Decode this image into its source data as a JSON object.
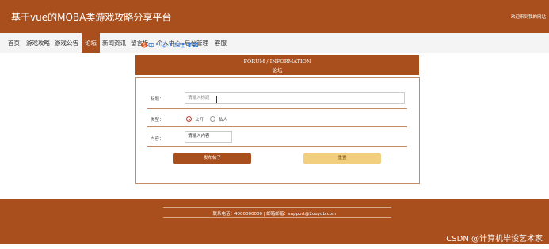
{
  "header": {
    "site_title": "基于vue的MOBA类游戏攻略分享平台",
    "welcome": "欢迎来到我的网站"
  },
  "nav": {
    "items": [
      {
        "label": "首页"
      },
      {
        "label": "游戏攻略"
      },
      {
        "label": "游戏公告"
      },
      {
        "label": "论坛",
        "active": true
      },
      {
        "label": "新闻资讯"
      },
      {
        "label": "留言板"
      },
      {
        "label": "个人中心"
      },
      {
        "label": "后台管理"
      },
      {
        "label": "客服"
      }
    ]
  },
  "toolbar": {
    "icons": [
      "sogou-s-icon",
      "chinese-zhong-icon",
      "punctuation-icon",
      "emoji-icon",
      "microphone-icon",
      "keyboard-icon",
      "user-icon",
      "shirt-icon",
      "grid-icon"
    ]
  },
  "section": {
    "title_en": "FORUM / INFORMATION",
    "title_cn": "论坛"
  },
  "form": {
    "title_label": "标题：",
    "title_placeholder": "请输入标题",
    "type_label": "类型：",
    "type_options": [
      {
        "label": "公开",
        "checked": true
      },
      {
        "label": "私人",
        "checked": false
      }
    ],
    "content_label": "内容：",
    "content_placeholder": "请输入内容",
    "submit_label": "发布帖子",
    "reset_label": "重置"
  },
  "footer": {
    "contact": "联系电话：4000000000 | 邮箱邮箱：support@2ouyub.com"
  },
  "watermark": "CSDN @计算机毕设艺术家",
  "colors": {
    "brand": "#a84f1d",
    "reset_button": "#f2cf7e",
    "card_border": "#c58a62"
  }
}
